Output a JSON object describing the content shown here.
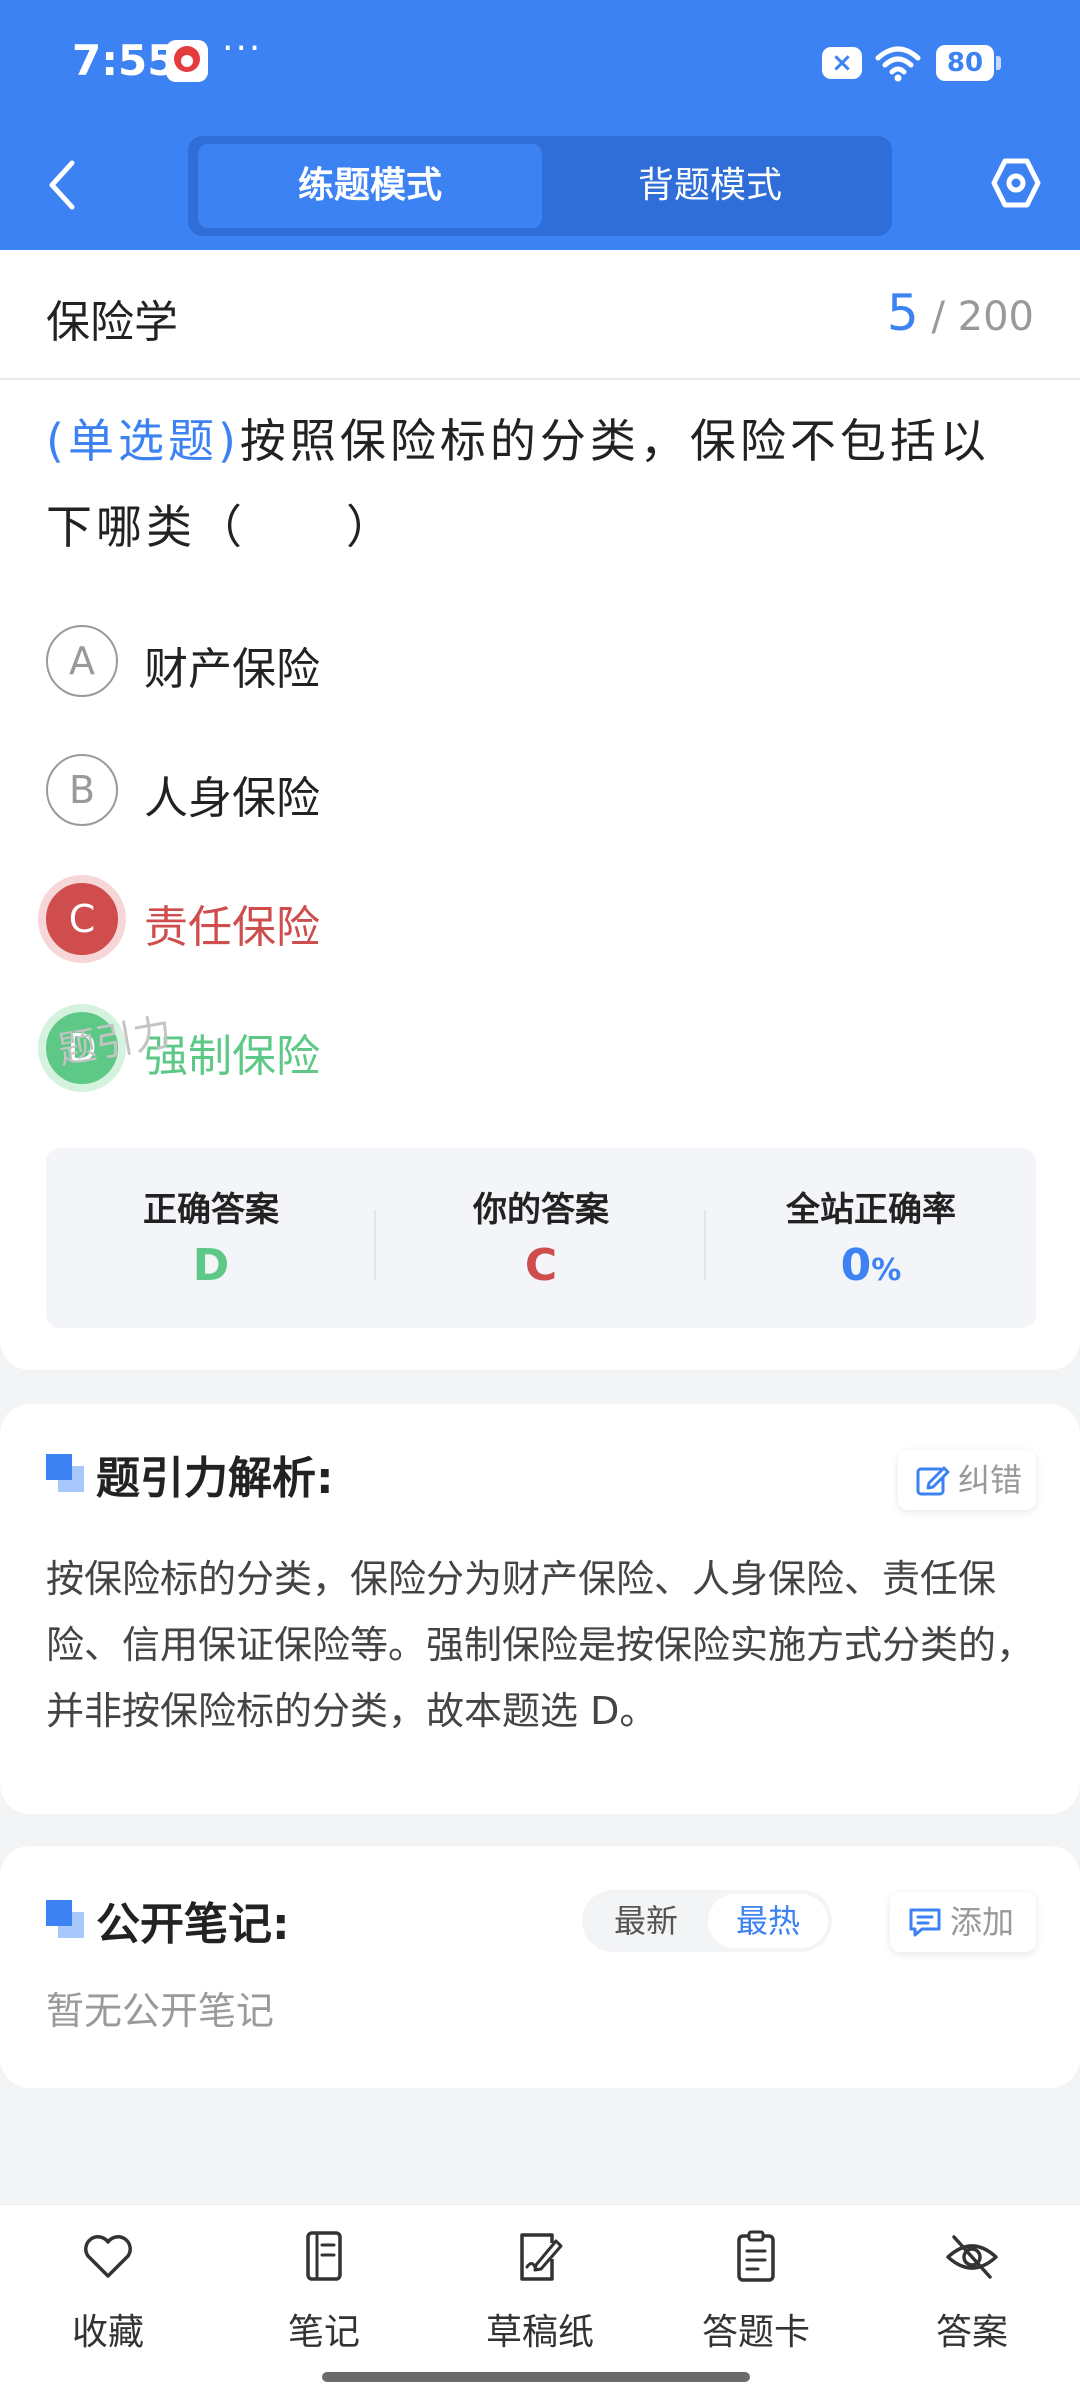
{
  "status_bar": {
    "time": "7:55",
    "dots": "···",
    "battery": "80"
  },
  "header": {
    "mode_practice": "练题模式",
    "mode_recite": "背题模式"
  },
  "question": {
    "subject": "保险学",
    "current": "5",
    "total": "/ 200",
    "type_label": "(单选题)",
    "text": "按照保险标的分类，保险不包括以下哪类（　　）",
    "options": [
      {
        "letter": "A",
        "text": "财产保险",
        "state": "normal"
      },
      {
        "letter": "B",
        "text": "人身保险",
        "state": "normal"
      },
      {
        "letter": "C",
        "text": "责任保险",
        "state": "wrong"
      },
      {
        "letter": "D",
        "text": "强制保险",
        "state": "correct"
      }
    ],
    "result": {
      "correct_label": "正确答案",
      "correct_value": "D",
      "yours_label": "你的答案",
      "yours_value": "C",
      "rate_label": "全站正确率",
      "rate_value": "0",
      "rate_unit": "%"
    },
    "watermark": "题引力"
  },
  "analysis": {
    "title": "题引力解析:",
    "report_label": "纠错",
    "text": "按保险标的分类，保险分为财产保险、人身保险、责任保险、信用保证保险等。强制保险是按保险实施方式分类的，并非按保险标的分类，故本题选 D。"
  },
  "notes": {
    "title": "公开笔记:",
    "sort_newest": "最新",
    "sort_hottest": "最热",
    "add_label": "添加",
    "empty_text": "暂无公开笔记"
  },
  "bottom_tabs": [
    {
      "label": "收藏",
      "icon": "heart-icon"
    },
    {
      "label": "笔记",
      "icon": "notebook-icon"
    },
    {
      "label": "草稿纸",
      "icon": "draft-icon"
    },
    {
      "label": "答题卡",
      "icon": "answer-card-icon"
    },
    {
      "label": "答案",
      "icon": "eye-off-icon"
    }
  ],
  "colors": {
    "primary": "#3d82f3",
    "wrong": "#cf4d4c",
    "correct": "#5ec886"
  }
}
